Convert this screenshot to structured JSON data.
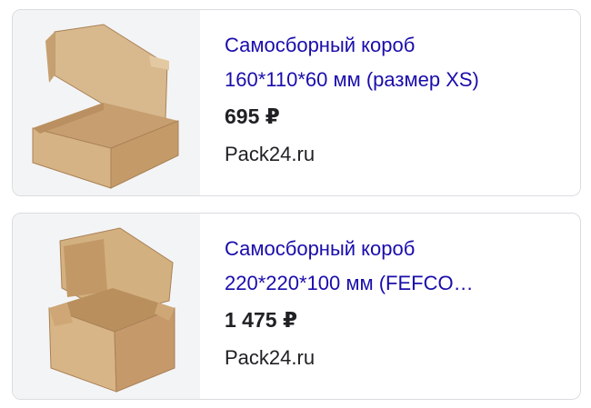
{
  "products": [
    {
      "title_line1": "Самосборный короб",
      "title_line2": "160*110*60 мм (размер XS)",
      "price": "695 ₽",
      "source": "Pack24.ru",
      "image_icon": "open-kraft-box-flat-icon"
    },
    {
      "title_line1": "Самосборный короб",
      "title_line2": "220*220*100 мм (FEFCO…",
      "price": "1 475 ₽",
      "source": "Pack24.ru",
      "image_icon": "open-kraft-box-tall-icon"
    }
  ],
  "colors": {
    "link": "#1a0dab",
    "text": "#202124",
    "border": "#dadce0",
    "kraft": "#c9a57a"
  }
}
